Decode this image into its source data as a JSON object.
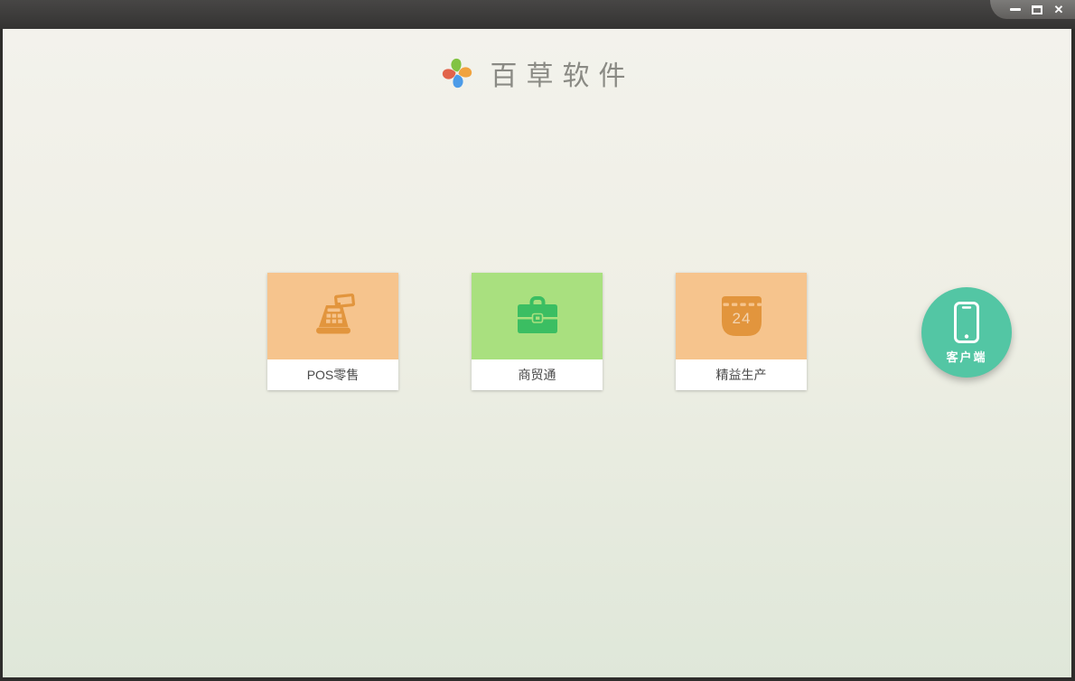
{
  "window": {
    "controls": {
      "minimize_name": "minimize",
      "maximize_name": "maximize",
      "close_name": "close",
      "close_glyph": "✕"
    },
    "titlebar_color": "#3d3c3b",
    "controls_panel_color": "#6e6d6b"
  },
  "header": {
    "app_name": "百草软件",
    "logo_petal_colors": {
      "top": "#82C342",
      "right": "#F0A33F",
      "bottom": "#4C9BE8",
      "left": "#E2634A"
    },
    "title_color": "#8A8A84"
  },
  "products": [
    {
      "label": "POS零售",
      "icon": "cash-register-icon",
      "tile_color": "#F6C48D",
      "icon_color": "#E2953D"
    },
    {
      "label": "商贸通",
      "icon": "briefcase-icon",
      "tile_color": "#A9E07F",
      "icon_color": "#3BBE62"
    },
    {
      "label": "精益生产",
      "icon": "calendar-icon",
      "calendar_day": "24",
      "tile_color": "#F6C48D",
      "icon_color": "#E2953D"
    }
  ],
  "client_button": {
    "label": "客户端",
    "icon": "smartphone-icon",
    "color": "#53C6A4"
  },
  "background": {
    "top_color": "#F3F2EC",
    "bottom_color": "#DFE7D9"
  }
}
